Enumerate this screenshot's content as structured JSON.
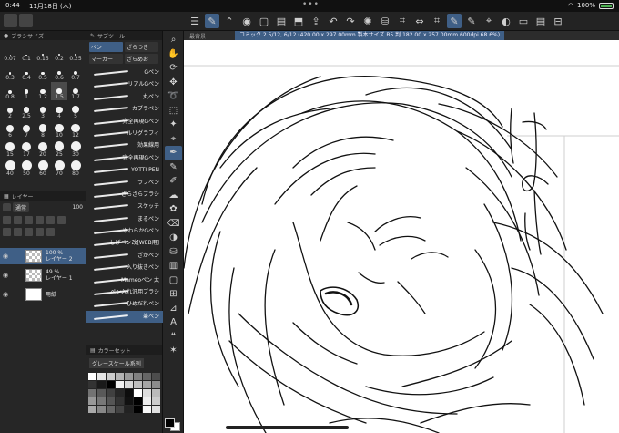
{
  "statusbar": {
    "time": "0:44",
    "date": "11月18日 (木)",
    "battery": "100%"
  },
  "panels": {
    "brush_size": {
      "title": "ブラシサイズ",
      "sizes": [
        "0.07",
        "0.1",
        "0.15",
        "0.2",
        "0.25",
        "0.3",
        "0.4",
        "0.5",
        "0.6",
        "0.7",
        "0.8",
        "1",
        "1.2",
        "1.5",
        "1.7",
        "2",
        "2.5",
        "3",
        "4",
        "5",
        "6",
        "7",
        "8",
        "10",
        "12",
        "15",
        "17",
        "20",
        "25",
        "30",
        "40",
        "50",
        "60",
        "70",
        "80"
      ],
      "selected": "1.5"
    },
    "subtool": {
      "title": "サブツール",
      "tabs": [
        "ペン",
        "ざらつき",
        "マーカー",
        "ざらめお"
      ],
      "items": [
        "Gペン",
        "リアルGペン",
        "丸ペン",
        "カブラペン",
        "完全再現Gペン",
        "ルリグラフィ",
        "効果線用",
        "完全再現Gペン",
        "YOTTI PEN",
        "ラフペン",
        "ざらざらブラシ",
        "スケッチ",
        "まるペン",
        "やわらかGペン",
        "しげペン改[WEB用]",
        "ざかペン",
        "入り抜きペン",
        "Mameoペン 太",
        "ペン入れ汎用ブラシ",
        "ひめだれペン",
        "筆ペン"
      ],
      "selected_index": 20
    },
    "layer": {
      "title": "レイヤー",
      "blend_mode": "通常",
      "opacity": "100",
      "layers": [
        {
          "opacity": "100 %",
          "name": "レイヤー 2",
          "active": true
        },
        {
          "opacity": "49 %",
          "name": "レイヤー 1",
          "active": false
        },
        {
          "opacity": "",
          "name": "用紙",
          "active": false
        }
      ]
    },
    "color_set": {
      "title": "カラーセット",
      "set_name": "グレースケール系列"
    }
  },
  "document_tab": {
    "label": "最背景",
    "title": "コミック 2 5/12, 6/12 (420.00 x 297.00mm 製本サイズ B5 判 182.00 x 257.00mm 600dpi 68.6%)"
  },
  "colors": {
    "accent": "#3f5f86",
    "panel": "#262626",
    "canvas": "#ffffff"
  },
  "icons": {
    "toolbar": [
      "menu-icon",
      "brush-active-icon",
      "chevron-icon",
      "record-icon",
      "new-icon",
      "open-icon",
      "save-icon",
      "share-icon",
      "undo-icon",
      "redo-icon",
      "loading-icon",
      "fill-icon",
      "transform-icon",
      "flip-h-icon",
      "transform2-icon",
      "pen-active-icon",
      "pen2-icon",
      "eyedropper-icon",
      "palette-icon",
      "layout-icon",
      "panel-icon",
      "hide-icon"
    ],
    "tools": [
      "zoom-icon",
      "hand-icon",
      "rotate-icon",
      "move-icon",
      "lasso-icon",
      "select-icon",
      "magic-wand-icon",
      "eyedropper-icon",
      "pen-icon",
      "pencil-icon",
      "brush-icon",
      "airbrush-icon",
      "decoration-icon",
      "eraser-icon",
      "blend-icon",
      "fill-icon",
      "gradient-icon",
      "figure-icon",
      "frame-icon",
      "ruler-icon",
      "text-icon",
      "balloon-icon",
      "correction-icon"
    ]
  }
}
